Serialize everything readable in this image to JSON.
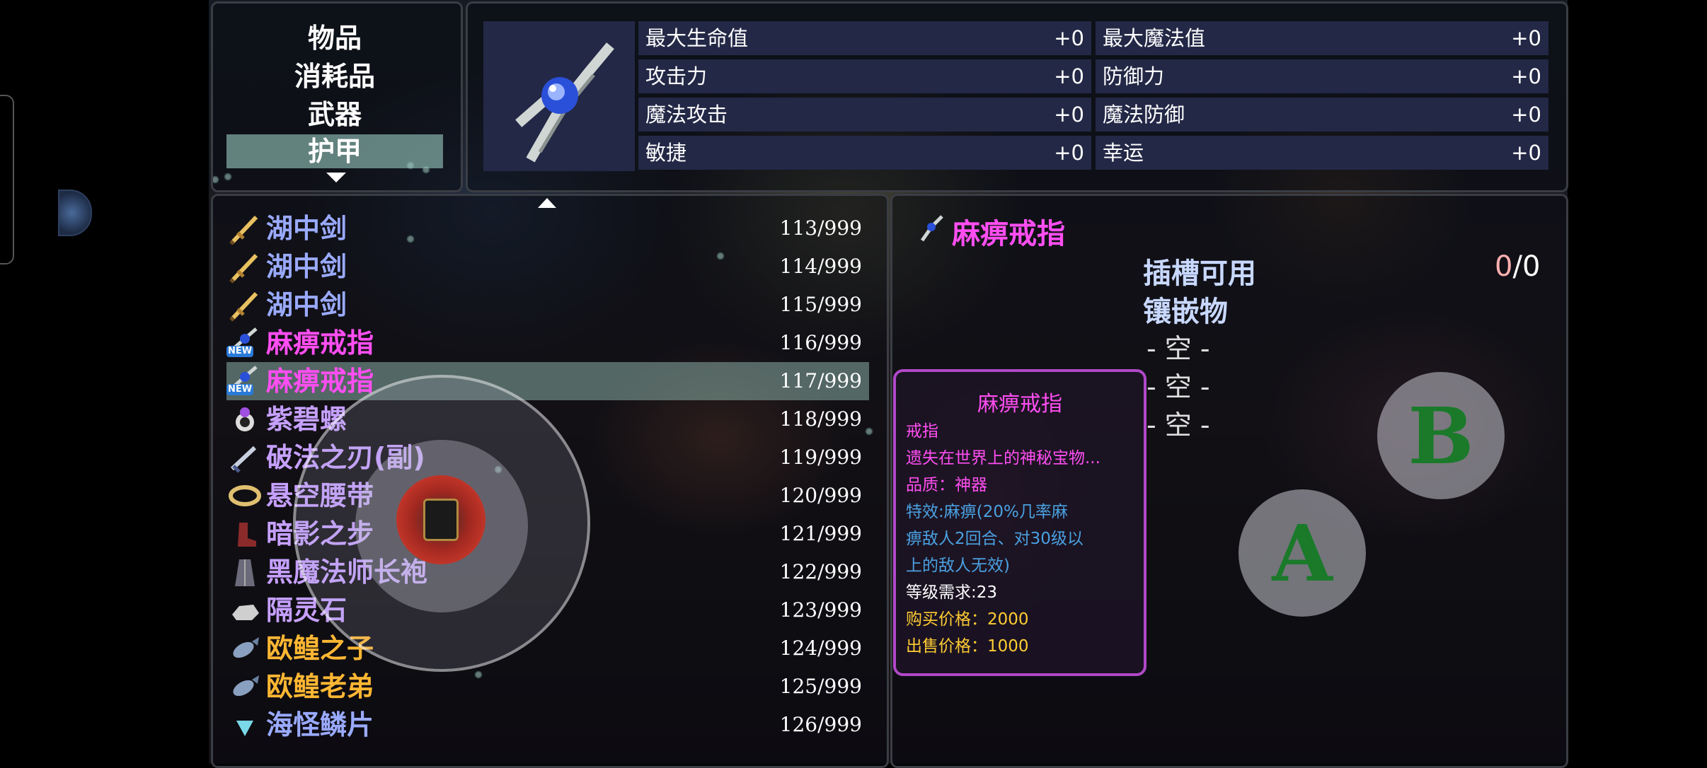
{
  "categories": [
    {
      "label": "物品",
      "selected": false
    },
    {
      "label": "消耗品",
      "selected": false
    },
    {
      "label": "武器",
      "selected": false
    },
    {
      "label": "护甲",
      "selected": true
    }
  ],
  "stats": {
    "left": [
      {
        "label": "最大生命值",
        "value": "+0"
      },
      {
        "label": "攻击力",
        "value": "+0"
      },
      {
        "label": "魔法攻击",
        "value": "+0"
      },
      {
        "label": "敏捷",
        "value": "+0"
      }
    ],
    "right": [
      {
        "label": "最大魔法值",
        "value": "+0"
      },
      {
        "label": "防御力",
        "value": "+0"
      },
      {
        "label": "魔法防御",
        "value": "+0"
      },
      {
        "label": "幸运",
        "value": "+0"
      }
    ]
  },
  "items": [
    {
      "name": "湖中剑",
      "qty": "113/999",
      "color": "#9aaaff",
      "icon": "sword-icon",
      "is_new": false
    },
    {
      "name": "湖中剑",
      "qty": "114/999",
      "color": "#9aaaff",
      "icon": "sword-icon",
      "is_new": false
    },
    {
      "name": "湖中剑",
      "qty": "115/999",
      "color": "#9aaaff",
      "icon": "sword-icon",
      "is_new": false
    },
    {
      "name": "麻痹戒指",
      "qty": "116/999",
      "color": "#ff4ef2",
      "icon": "ring-icon",
      "is_new": true
    },
    {
      "name": "麻痹戒指",
      "qty": "117/999",
      "color": "#ff4ef2",
      "icon": "ring-icon",
      "is_new": true,
      "selected": true
    },
    {
      "name": "紫碧螺",
      "qty": "118/999",
      "color": "#c6a0ff",
      "icon": "purple-orb-icon",
      "is_new": false
    },
    {
      "name": "破法之刃(副)",
      "qty": "119/999",
      "color": "#c6a0ff",
      "icon": "dagger-icon",
      "is_new": false
    },
    {
      "name": "悬空腰带",
      "qty": "120/999",
      "color": "#c6a0ff",
      "icon": "belt-icon",
      "is_new": false
    },
    {
      "name": "暗影之步",
      "qty": "121/999",
      "color": "#c6a0ff",
      "icon": "boot-icon",
      "is_new": false
    },
    {
      "name": "黑魔法师长袍",
      "qty": "122/999",
      "color": "#c6a0ff",
      "icon": "robe-icon",
      "is_new": false
    },
    {
      "name": "隔灵石",
      "qty": "123/999",
      "color": "#c6a0ff",
      "icon": "stone-icon",
      "is_new": false
    },
    {
      "name": "欧鳇之子",
      "qty": "124/999",
      "color": "#ffb733",
      "icon": "fish-icon",
      "is_new": false
    },
    {
      "name": "欧鳇老弟",
      "qty": "125/999",
      "color": "#ffb733",
      "icon": "fish-icon",
      "is_new": false
    },
    {
      "name": "海怪鳞片",
      "qty": "126/999",
      "color": "#9aaaff",
      "icon": "scale-icon",
      "is_new": false
    }
  ],
  "new_badge": "NEW",
  "detail": {
    "title": "麻痹戒指",
    "slot_label": "插槽可用",
    "slot_used": "0",
    "slot_sep": "/",
    "slot_total": "0",
    "socket_label": "镶嵌物",
    "empty_slots": [
      "- 空 -",
      "- 空 -",
      "- 空 -"
    ]
  },
  "tooltip": {
    "title": "麻痹戒指",
    "lines": [
      {
        "text": "戒指",
        "color": "#ff4ef2"
      },
      {
        "text": "遗失在世界上的神秘宝物...",
        "color": "#ff4ef2"
      },
      {
        "text": "品质：神器",
        "color": "#ff4ef2"
      },
      {
        "text": "特效:麻痹(20%几率麻",
        "color": "#4aa0e0"
      },
      {
        "text": "痹敌人2回合、对30级以",
        "color": "#4aa0e0"
      },
      {
        "text": "上的敌人无效)",
        "color": "#4aa0e0"
      },
      {
        "text": "等级需求:23",
        "color": "#ffffff"
      },
      {
        "text": "购买价格：2000",
        "color": "#ffcc33"
      },
      {
        "text": "出售价格：1000",
        "color": "#ffcc33"
      }
    ]
  },
  "buttons": {
    "a": "A",
    "b": "B"
  }
}
